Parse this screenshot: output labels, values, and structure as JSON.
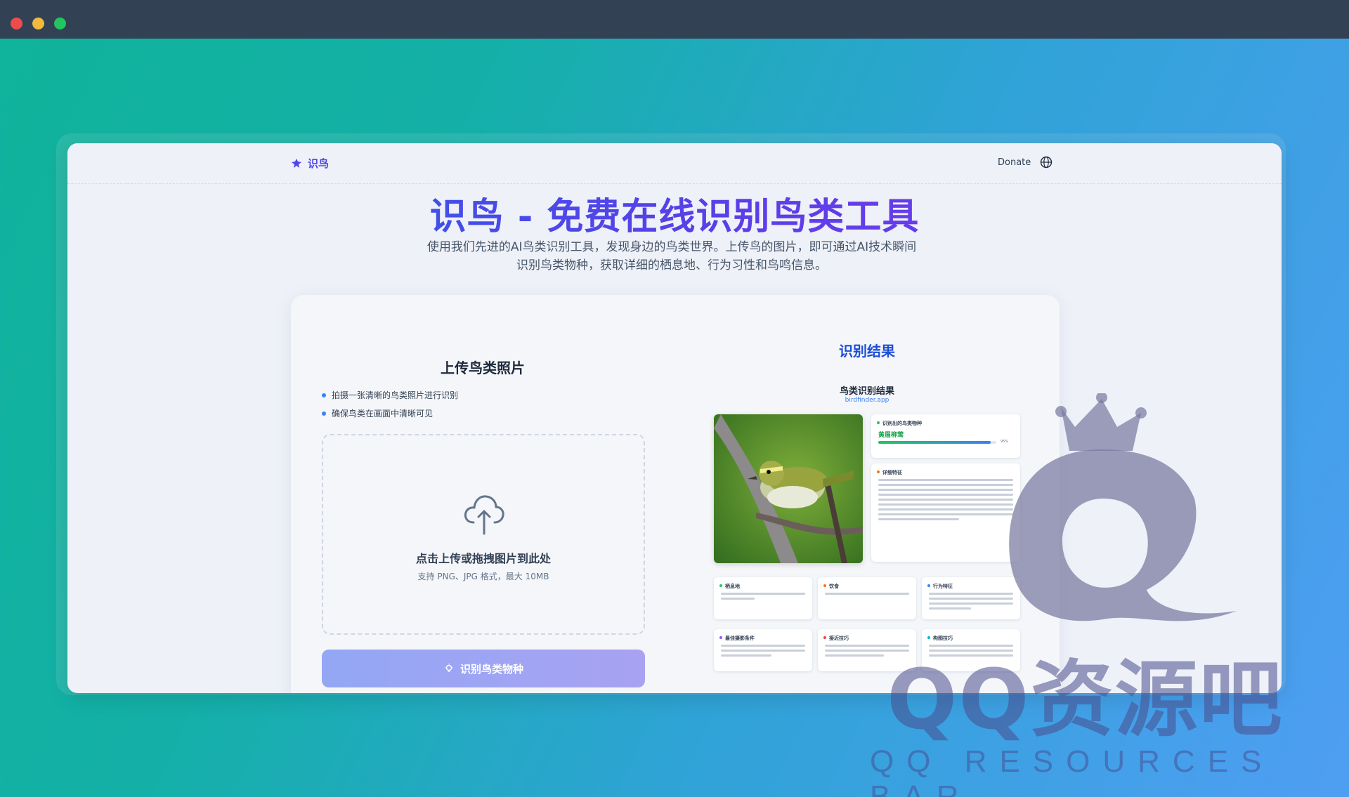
{
  "nav": {
    "logo_text": "识鸟",
    "donate_label": "Donate"
  },
  "hero": {
    "title": "识鸟 - 免费在线识别鸟类工具",
    "subtitle": "使用我们先进的AI鸟类识别工具，发现身边的鸟类世界。上传鸟的图片，即可通过AI技术瞬间识别鸟类物种，获取详细的栖息地、行为习性和鸟鸣信息。"
  },
  "upload": {
    "title": "上传鸟类照片",
    "tips": [
      "拍摄一张清晰的鸟类照片进行识别",
      "确保鸟类在画面中清晰可见"
    ],
    "dropzone_main": "点击上传或拖拽图片到此处",
    "dropzone_sub": "支持 PNG、JPG 格式，最大 10MB",
    "button_label": "识别鸟类物种"
  },
  "result": {
    "title": "识别结果",
    "card_title": "鸟类识别结果",
    "card_domain": "birdfinder.app",
    "species_header": "识别出的鸟类物种",
    "species_name": "黄眉柳莺",
    "confidence": 0.95,
    "confidence_label": "95%",
    "details_header": "详细特征",
    "sections": [
      "栖息地",
      "饮食",
      "行为特征",
      "最佳摄影条件",
      "接近技巧",
      "构图技巧"
    ]
  },
  "watermark": {
    "text": "QQ资源吧",
    "sub": "QQ RESOURCES BAR"
  },
  "colors": {
    "accent": "#4f46e5",
    "title_bar": "#334155",
    "button": "#a5a8f4",
    "result_title": "#1d4ed8"
  }
}
